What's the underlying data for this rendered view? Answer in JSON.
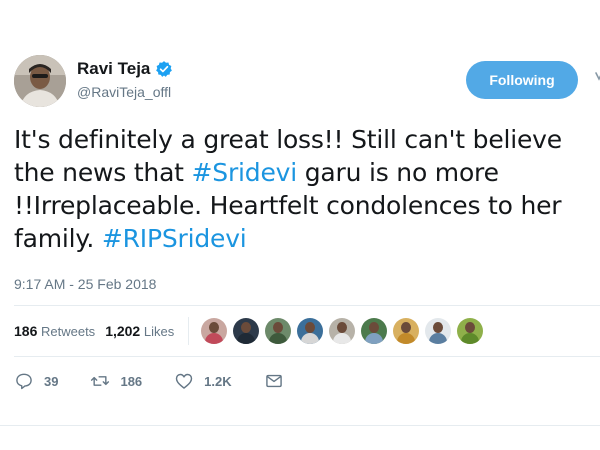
{
  "colors": {
    "accent": "#1b95e0",
    "following_bg": "#52a9e6",
    "verified": "#1da1f2",
    "muted": "#657786",
    "text": "#14171a"
  },
  "user": {
    "display_name": "Ravi Teja",
    "handle": "@RaviTeja_offl",
    "verified_icon": "verified-badge-icon"
  },
  "follow_button": {
    "label": "Following"
  },
  "tweet": {
    "segments": [
      {
        "text": "It's definitely a great loss!! Still can't believe the news that ",
        "type": "text"
      },
      {
        "text": "#Sridevi",
        "type": "hashtag"
      },
      {
        "text": " garu is no more !!Irreplaceable. Heartfelt condolences to her family. ",
        "type": "text"
      },
      {
        "text": "#RIPSridevi",
        "type": "hashtag"
      }
    ],
    "timestamp": "9:17 AM - 25 Feb 2018"
  },
  "stats": {
    "retweets_count": "186",
    "retweets_label": "Retweets",
    "likes_count": "1,202",
    "likes_label": "Likes",
    "liker_avatars": [
      {
        "bg": "#c9a7a0",
        "shirt": "#c14a5a"
      },
      {
        "bg": "#2d3a4a",
        "shirt": "#1f2a36"
      },
      {
        "bg": "#6d8a6a",
        "shirt": "#3e5a3c"
      },
      {
        "bg": "#3b6f9a",
        "shirt": "#d6d6d6"
      },
      {
        "bg": "#b7b2a8",
        "shirt": "#e8e8e8"
      },
      {
        "bg": "#4c7a4c",
        "shirt": "#7fa0c0"
      },
      {
        "bg": "#d8b060",
        "shirt": "#c28a2a"
      },
      {
        "bg": "#e3e8ec",
        "shirt": "#5a7ea0"
      },
      {
        "bg": "#8fb04a",
        "shirt": "#5e8a2a"
      }
    ]
  },
  "actions": {
    "reply": {
      "icon": "reply-icon",
      "count": "39"
    },
    "retweet": {
      "icon": "retweet-icon",
      "count": "186"
    },
    "like": {
      "icon": "heart-icon",
      "count": "1.2K"
    },
    "message": {
      "icon": "envelope-icon"
    }
  }
}
